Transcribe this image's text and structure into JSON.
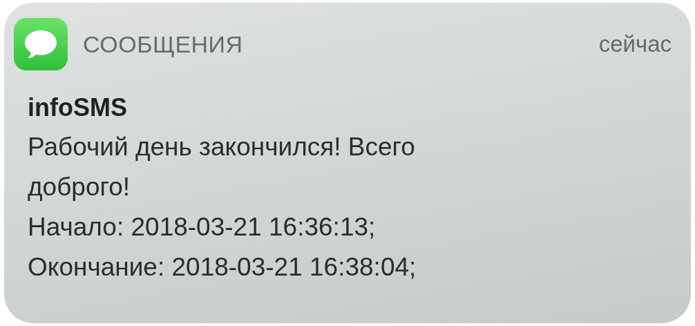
{
  "notification": {
    "app": "СООБЩЕНИЯ",
    "time": "сейчас",
    "sender": "infoSMS",
    "lines": [
      "Рабочий день закончился! Всего",
      "доброго!",
      "Начало: 2018-03-21 16:36:13;",
      "Окончание: 2018-03-21 16:38:04;"
    ]
  }
}
